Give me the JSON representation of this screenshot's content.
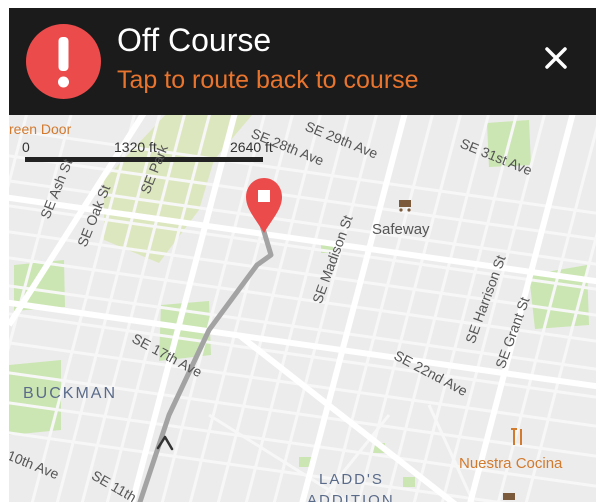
{
  "alert": {
    "icon": "exclamation-icon",
    "title": "Off Course",
    "subtitle": "Tap to route back to course",
    "close_icon": "close-icon",
    "colors": {
      "banner": "#1b1b1b",
      "accent": "#ec4b4b",
      "subtitle": "#e8742e"
    }
  },
  "map": {
    "scale": {
      "labels": [
        "0",
        "1320 ft",
        "2640 ft"
      ]
    },
    "streets": [
      "SE 28th Ave",
      "SE 29th Ave",
      "SE 31st Ave",
      "SE Ash St",
      "SE Oak St",
      "SE Park",
      "SE Madison St",
      "SE Harrison St",
      "SE Grant St",
      "SE 17th Ave",
      "SE 22nd Ave",
      "10th Ave",
      "SE 11th"
    ],
    "neighborhoods": [
      "BUCKMAN",
      "LADD'S",
      "ADDITION"
    ],
    "pois": [
      {
        "name": "Safeway",
        "icon": "shopping-cart-icon",
        "color": "#555555"
      },
      {
        "name": "Nuestra Cocina",
        "icon": "fork-knife-icon",
        "color": "#d27a2e"
      },
      {
        "name": "reen Door",
        "color": "#d27a2e"
      }
    ],
    "destination_marker": "map-pin-icon",
    "route_arrow": "direction-arrow-icon"
  }
}
